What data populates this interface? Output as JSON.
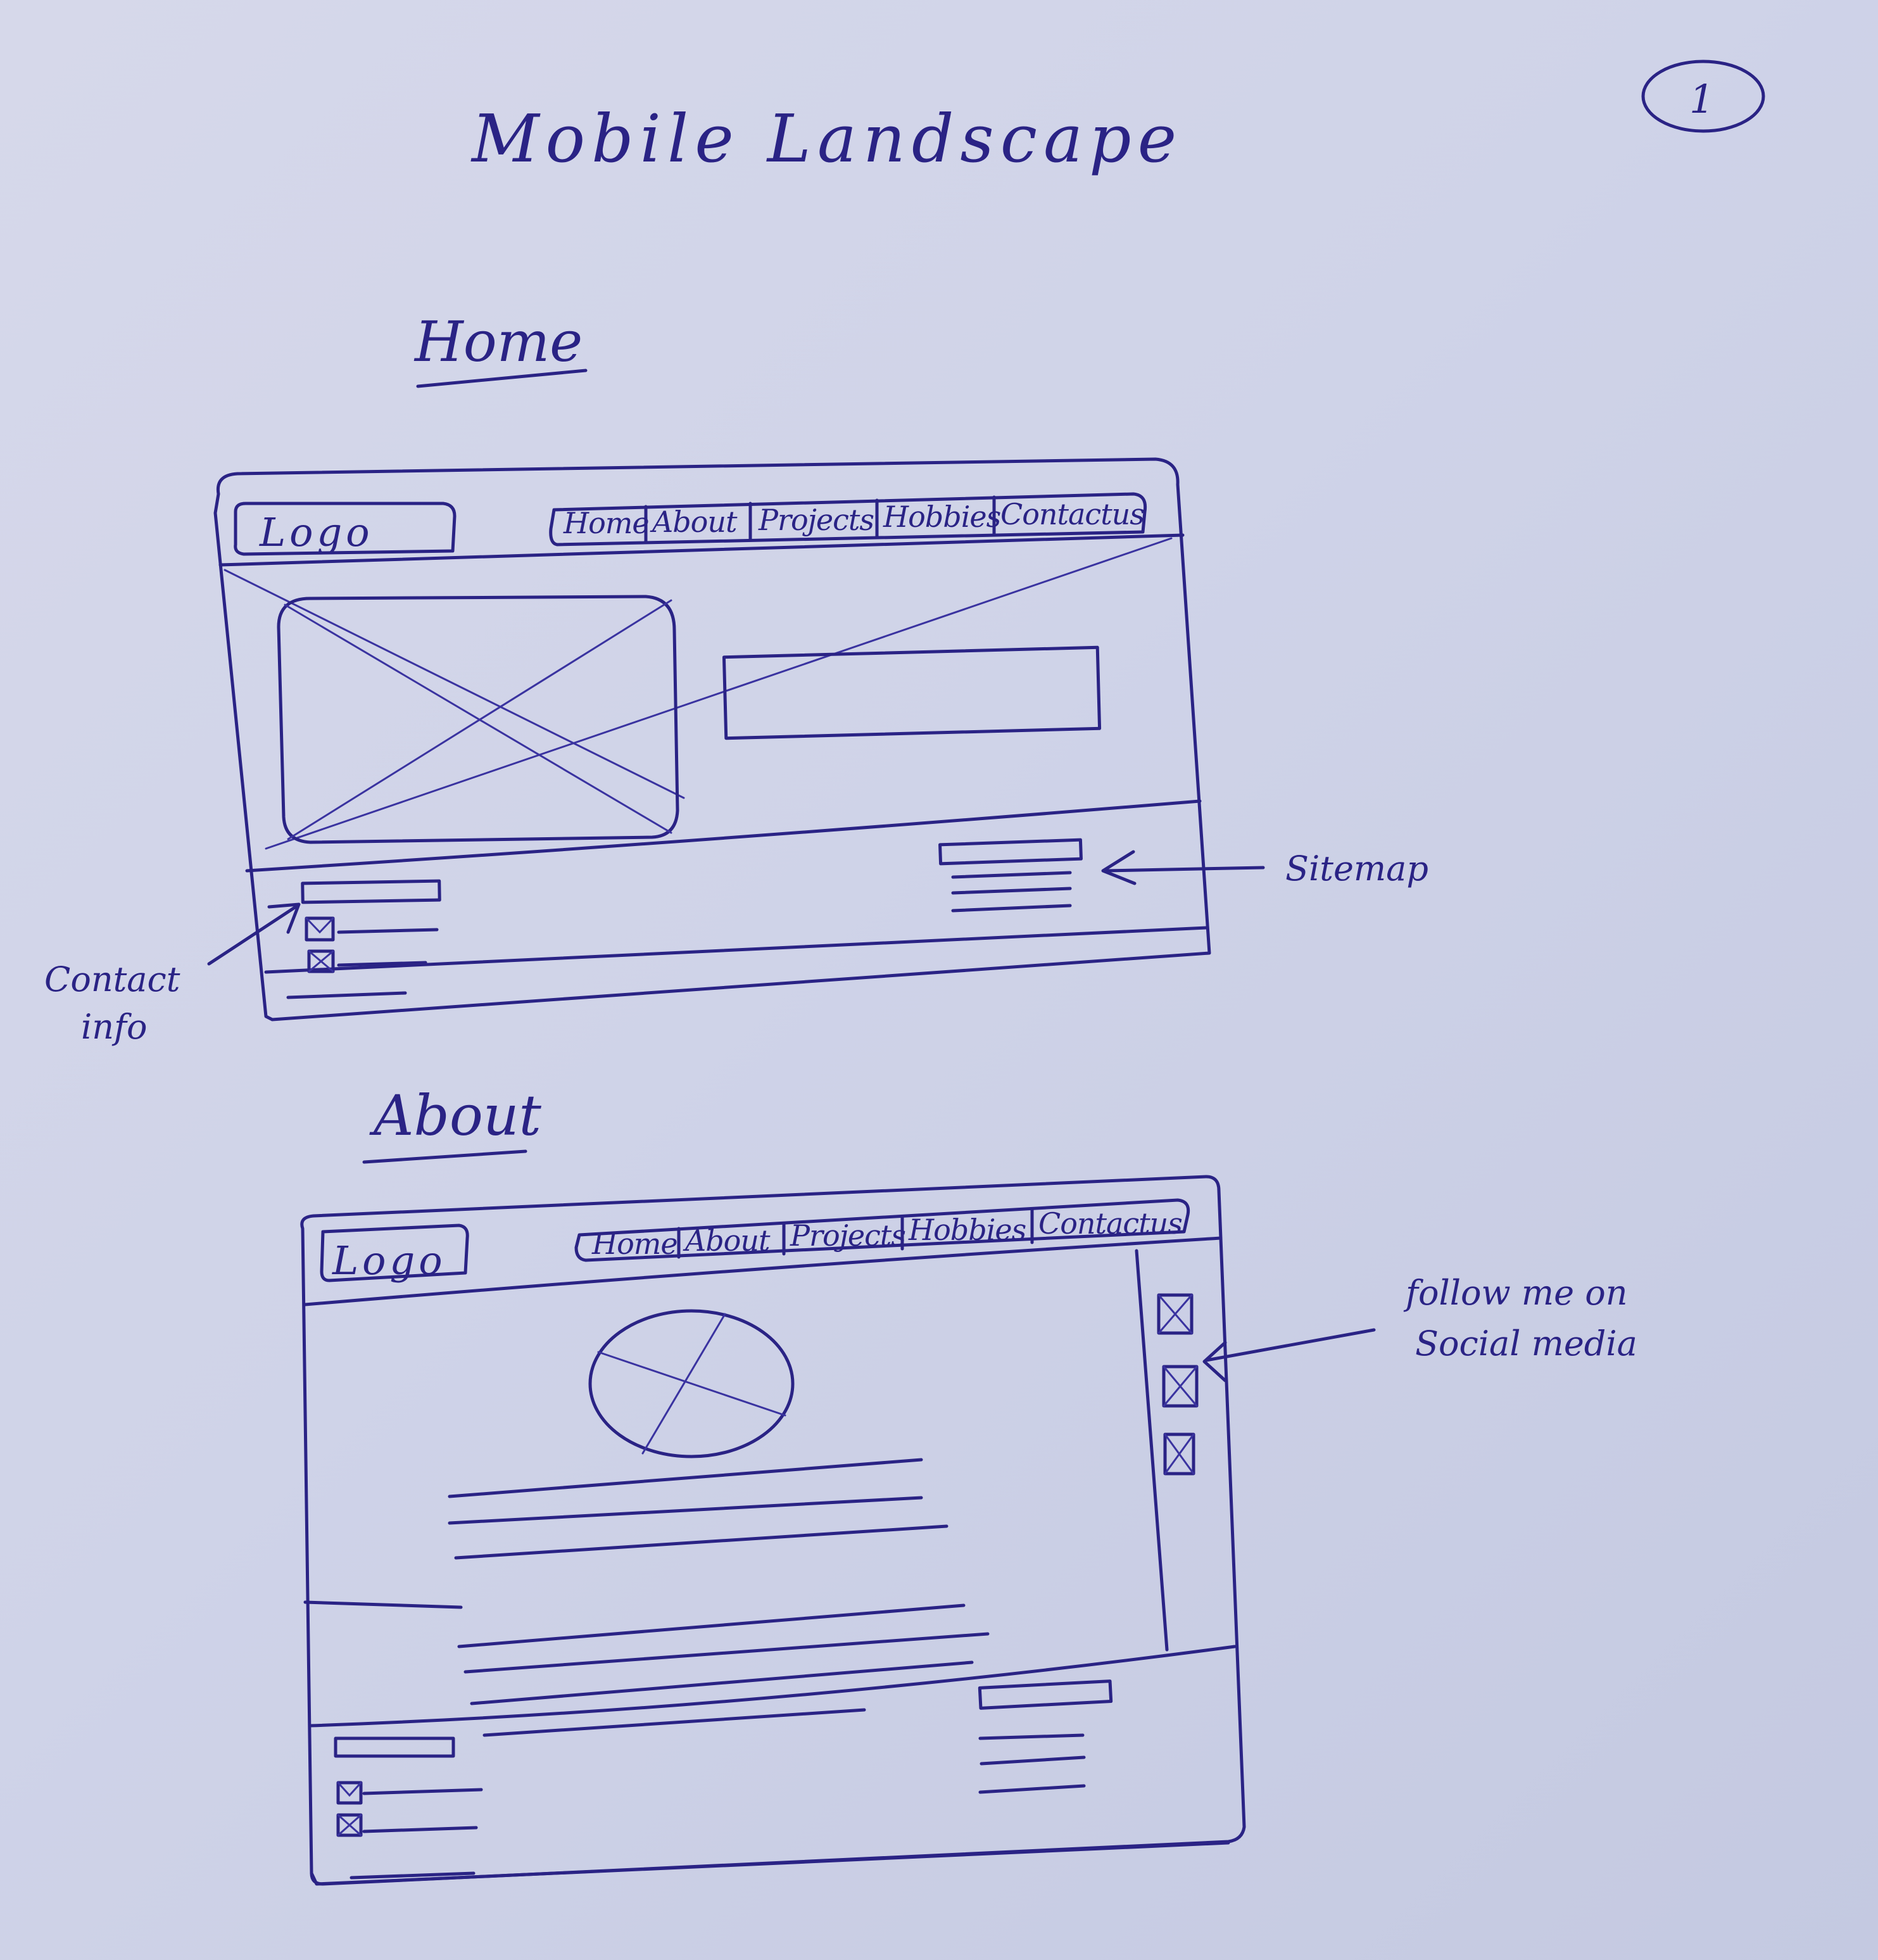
{
  "page": {
    "title": "Mobile Landscape",
    "number": "1"
  },
  "sections": [
    {
      "heading": "Home",
      "logo": "Logo",
      "nav": [
        "Home",
        "About",
        "Projects",
        "Hobbies",
        "Contactus"
      ]
    },
    {
      "heading": "About",
      "logo": "Logo",
      "nav": [
        "Home",
        "About",
        "Projects",
        "Hobbies",
        "Contactus"
      ]
    }
  ],
  "annotations": {
    "sitemap": "Sitemap",
    "contact_info_line1": "Contact",
    "contact_info_line2": "info",
    "social_line1": "follow me on",
    "social_line2": "Social media"
  },
  "colors": {
    "ink": "#2a2385",
    "paper": "#d3d6ea"
  }
}
